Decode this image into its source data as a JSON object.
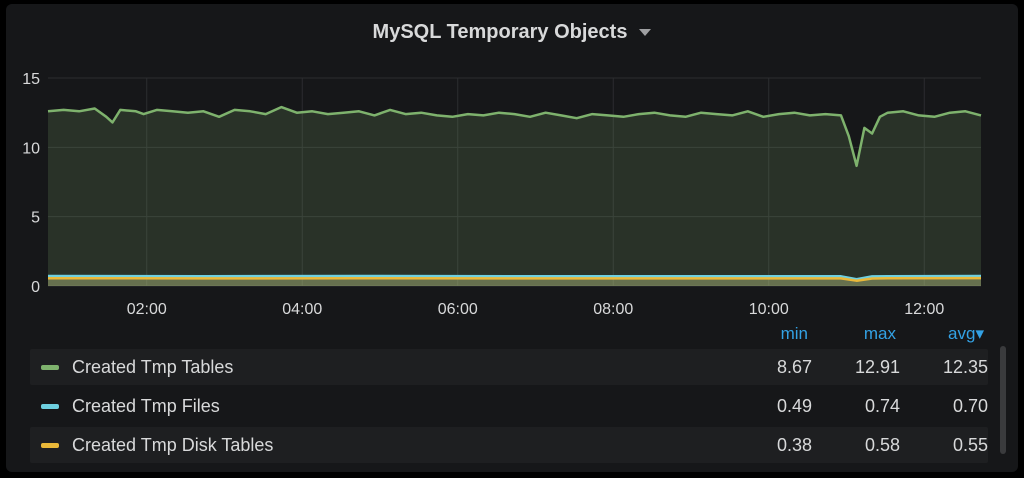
{
  "panel": {
    "title": "MySQL Temporary Objects",
    "caret_icon": "caret-down-icon"
  },
  "chart_data": {
    "type": "area",
    "title": "MySQL Temporary Objects",
    "x_tick_labels": [
      "02:00",
      "04:00",
      "06:00",
      "08:00",
      "10:00",
      "12:00"
    ],
    "x_range_hours": [
      0.73,
      12.73
    ],
    "y_ticks": [
      0,
      5,
      10,
      15
    ],
    "ylim": [
      0,
      15
    ],
    "grid": true,
    "legend_placement": "bottom",
    "series": [
      {
        "name": "Created Tmp Tables",
        "color": "#7eb26d",
        "x": [
          0.73,
          0.93,
          1.13,
          1.33,
          1.48,
          1.56,
          1.66,
          1.86,
          1.96,
          2.13,
          2.33,
          2.53,
          2.73,
          2.93,
          3.13,
          3.33,
          3.53,
          3.73,
          3.93,
          4.13,
          4.33,
          4.53,
          4.73,
          4.93,
          5.13,
          5.33,
          5.53,
          5.73,
          5.93,
          6.13,
          6.33,
          6.53,
          6.73,
          6.93,
          7.13,
          7.33,
          7.53,
          7.73,
          7.93,
          8.13,
          8.33,
          8.53,
          8.73,
          8.93,
          9.13,
          9.33,
          9.53,
          9.73,
          9.93,
          10.13,
          10.33,
          10.53,
          10.73,
          10.93,
          11.03,
          11.13,
          11.23,
          11.33,
          11.43,
          11.53,
          11.73,
          11.93,
          12.13,
          12.33,
          12.53,
          12.73
        ],
        "y": [
          12.6,
          12.7,
          12.6,
          12.8,
          12.2,
          11.8,
          12.7,
          12.6,
          12.4,
          12.7,
          12.6,
          12.5,
          12.6,
          12.2,
          12.7,
          12.6,
          12.4,
          12.9,
          12.5,
          12.6,
          12.4,
          12.5,
          12.6,
          12.3,
          12.7,
          12.4,
          12.5,
          12.3,
          12.2,
          12.4,
          12.3,
          12.5,
          12.4,
          12.2,
          12.5,
          12.3,
          12.1,
          12.4,
          12.3,
          12.2,
          12.4,
          12.5,
          12.3,
          12.2,
          12.5,
          12.4,
          12.3,
          12.6,
          12.2,
          12.4,
          12.5,
          12.3,
          12.4,
          12.3,
          10.8,
          8.67,
          11.4,
          11.0,
          12.2,
          12.5,
          12.6,
          12.3,
          12.2,
          12.5,
          12.6,
          12.3
        ]
      },
      {
        "name": "Created Tmp Files",
        "color": "#6ed0e0",
        "x": [
          0.73,
          2.73,
          4.73,
          6.73,
          8.73,
          10.73,
          10.93,
          11.13,
          11.33,
          11.53,
          12.73
        ],
        "y": [
          0.72,
          0.71,
          0.72,
          0.7,
          0.7,
          0.71,
          0.7,
          0.49,
          0.69,
          0.71,
          0.72
        ]
      },
      {
        "name": "Created Tmp Disk Tables",
        "color": "#eab839",
        "x": [
          0.73,
          2.73,
          4.73,
          6.73,
          8.73,
          10.73,
          10.93,
          11.13,
          11.33,
          11.53,
          12.73
        ],
        "y": [
          0.56,
          0.55,
          0.56,
          0.55,
          0.55,
          0.55,
          0.55,
          0.38,
          0.54,
          0.56,
          0.57
        ]
      }
    ],
    "legend_table": {
      "columns": [
        "min",
        "max",
        "avg"
      ],
      "sort_indicator": "▾",
      "rows": [
        {
          "name": "Created Tmp Tables",
          "min": "8.67",
          "max": "12.91",
          "avg": "12.35"
        },
        {
          "name": "Created Tmp Files",
          "min": "0.49",
          "max": "0.74",
          "avg": "0.70"
        },
        {
          "name": "Created Tmp Disk Tables",
          "min": "0.38",
          "max": "0.58",
          "avg": "0.55"
        }
      ]
    }
  },
  "legend": {
    "header_min": "min",
    "header_max": "max",
    "header_avg": "avg▾",
    "rows": [
      {
        "name": "Created Tmp Tables",
        "min": "8.67",
        "max": "12.91",
        "avg": "12.35",
        "color": "#7eb26d"
      },
      {
        "name": "Created Tmp Files",
        "min": "0.49",
        "max": "0.74",
        "avg": "0.70",
        "color": "#6ed0e0"
      },
      {
        "name": "Created Tmp Disk Tables",
        "min": "0.38",
        "max": "0.58",
        "avg": "0.55",
        "color": "#eab839"
      }
    ]
  }
}
